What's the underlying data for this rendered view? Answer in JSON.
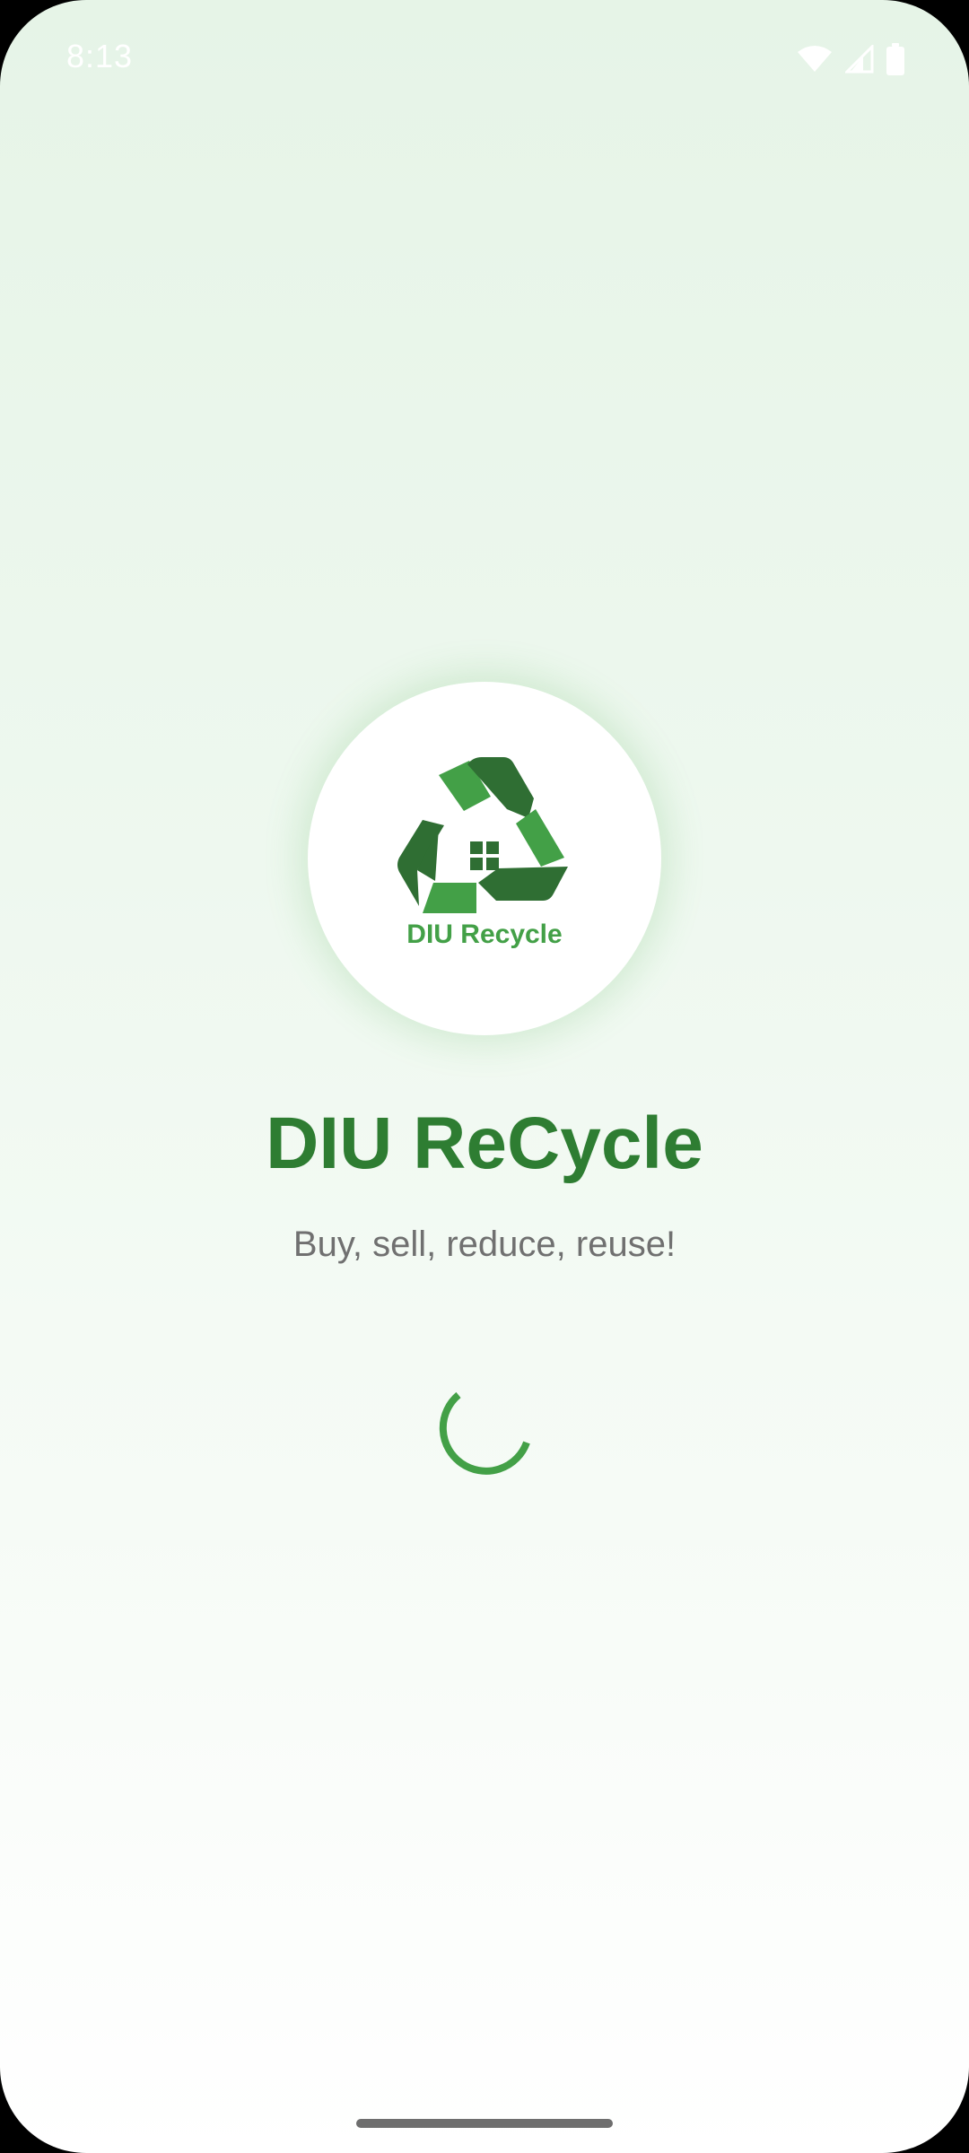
{
  "status_bar": {
    "time": "8:13",
    "icons": [
      "wifi-icon",
      "cellular-signal-icon",
      "battery-icon"
    ]
  },
  "logo": {
    "text": "DIU Recycle",
    "icon": "recycle-house-icon"
  },
  "app": {
    "title": "DIU ReCycle",
    "tagline": "Buy, sell, reduce, reuse!"
  },
  "loading": {
    "icon": "loading-spinner-icon"
  },
  "colors": {
    "primary_green": "#2e7d32",
    "light_green": "#43a047",
    "dark_green": "#2f6e33",
    "tagline_gray": "#707070",
    "background_top": "#e6f4e7"
  }
}
